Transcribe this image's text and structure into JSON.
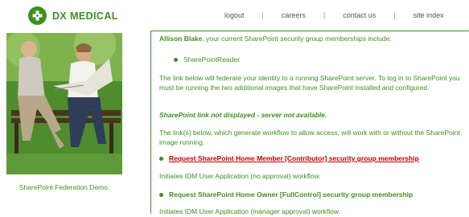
{
  "brand": {
    "name": "DX MEDICAL"
  },
  "nav": {
    "items": [
      "logout",
      "careers",
      "contact us",
      "site index"
    ]
  },
  "sidebar": {
    "caption": "SharePoint Federation Demo."
  },
  "main": {
    "user_name": "Allison Blake",
    "intro_suffix": ", your current SharePoint security group memberships include:",
    "groups": [
      "SharePointReader"
    ],
    "federate_text": "The link below will federate your identity to a running SharePoint server. To log in to SharePoint you must be running the two additional images that have SharePoint installed and configured.",
    "status_text": "SharePoint link not displayed - server not available.",
    "workflow_intro": "The link(s) below, which generate workflow to allow access, will work with or without the SharePoint image running.",
    "requests": [
      {
        "label": "Request SharePoint Home Member [Contributor] security group membership",
        "note": "Initiates IDM User Application (no approval) workflow."
      },
      {
        "label": "Request SharePoint Home Owner [FullControl] security group membership",
        "note": "Initiates IDM User Application (manager approval) workflow."
      }
    ]
  },
  "colors": {
    "brand_green": "#3f8f1f",
    "link_red": "#c00000"
  }
}
